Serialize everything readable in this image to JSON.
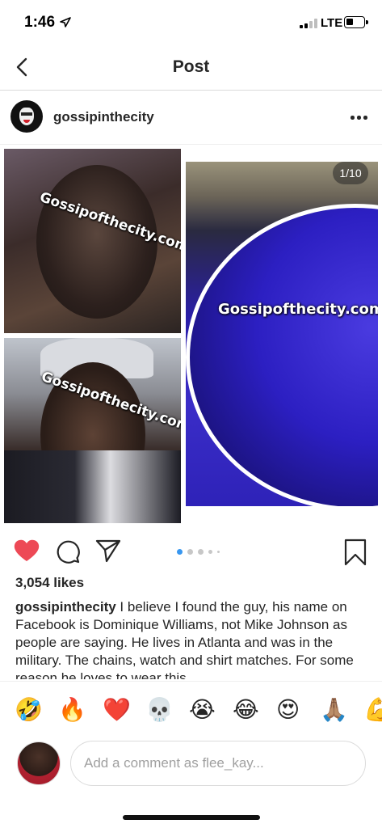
{
  "status_bar": {
    "time": "1:46",
    "network": "LTE"
  },
  "nav": {
    "title": "Post"
  },
  "post": {
    "username": "gossipinthecity",
    "image_counter": "1/10",
    "watermark": "Gossipofthecity.com",
    "carousel_total": 5,
    "carousel_active": 1,
    "likes": "3,054 likes",
    "liked": true,
    "caption_user": "gossipinthecity",
    "caption_text": "I believe I found the guy, his name on Facebook is Dominique Williams, not Mike Johnson as people are saying. He lives in Atlanta and was in the military. The chains, watch and shirt matches. For some reason he loves to wear this"
  },
  "emoji_bar": [
    "🤣",
    "🔥",
    "❤️",
    "💀",
    "😭",
    "😂",
    "😍",
    "🙏🏽",
    "💪"
  ],
  "comment": {
    "placeholder": "Add a comment as flee_kay..."
  },
  "colors": {
    "heart": "#ed4956",
    "text": "#262626",
    "active_dot": "#3897f0"
  }
}
